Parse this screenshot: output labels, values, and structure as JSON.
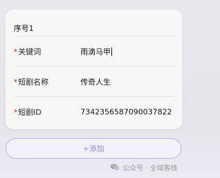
{
  "card": {
    "title": "序号1",
    "rows": [
      {
        "required_mark": "*",
        "label": "关键词",
        "value": "雨滴马甲"
      },
      {
        "required_mark": "*",
        "label": "短剧名称",
        "value": "传奇人生"
      },
      {
        "required_mark": "*",
        "label": "短剧ID",
        "value": "7342356587090037822"
      }
    ]
  },
  "actions": {
    "add_label": "+添加"
  },
  "watermark": {
    "icon": "wechat-icon",
    "text": "公众号 · 全域客栈"
  }
}
